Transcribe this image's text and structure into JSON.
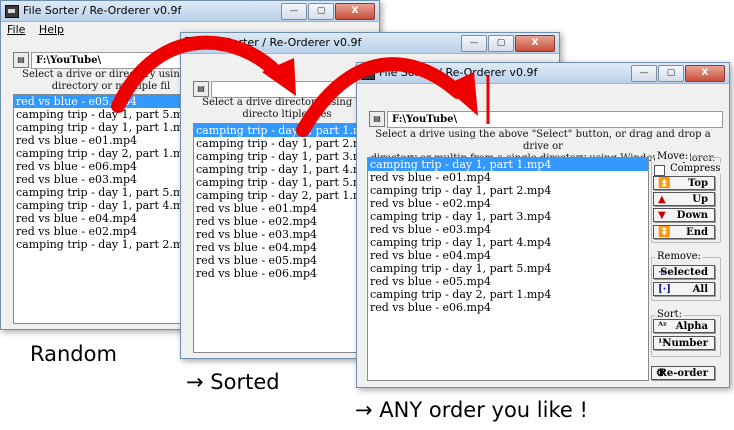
{
  "app": {
    "title": "File Sorter / Re-Orderer v0.9f",
    "title_btns": [
      "—",
      "▢",
      "X"
    ]
  },
  "menu": {
    "file": "File",
    "help": "Help"
  },
  "path": "F:\\YouTube\\",
  "instructions": {
    "win1_line1": "Select a drive or directory using th",
    "win1_line2": "directory or multiple fil",
    "win2_line1": "Select a drive          directory using the",
    "win2_line2": "directo          ltiple files",
    "win3_line1": "Select a drive          using the above \"Select\" button,  or drag and drop a drive or",
    "win3_line2": "directory or multip          from a single directory using Windows Explorer."
  },
  "random_list": [
    "red vs blue - e05.mp4",
    "camping trip - day 1, part 5.mp4",
    "camping trip - day 1, part 1.mp4",
    "red vs blue - e01.mp4",
    "camping trip - day 2, part 1.mp4",
    "red vs blue - e06.mp4",
    "red vs blue - e03.mp4",
    "camping trip - day 1, part 5.mp4",
    "camping trip - day 1, part 4.mp4",
    "red vs blue - e04.mp4",
    "red vs blue - e02.mp4",
    "camping trip - day 1, part 2.mp4"
  ],
  "sorted_list": [
    "camping trip - day 1, part 1.mp4",
    "camping trip - day 1, part 2.mp4",
    "camping trip - day 1, part 3.mp4",
    "camping trip - day 1, part 4.mp4",
    "camping trip - day 1, part 5.mp4",
    "camping trip - day 2, part 1.mp4",
    "red vs blue - e01.mp4",
    "red vs blue - e02.mp4",
    "red vs blue - e03.mp4",
    "red vs blue - e04.mp4",
    "red vs blue - e05.mp4",
    "red vs blue - e06.mp4"
  ],
  "custom_list": [
    "camping trip - day 1, part 1.mp4",
    "red vs blue - e01.mp4",
    "camping trip - day 1, part 2.mp4",
    "red vs blue - e02.mp4",
    "camping trip - day 1, part 3.mp4",
    "red vs blue - e03.mp4",
    "camping trip - day 1, part 4.mp4",
    "red vs blue - e04.mp4",
    "camping trip - day 1, part 5.mp4",
    "red vs blue - e05.mp4",
    "camping trip - day 2, part 1.mp4",
    "red vs blue - e06.mp4"
  ],
  "panel": {
    "move_label": "Move:",
    "compress": "Compress",
    "top": "Top",
    "up": "Up",
    "down": "Down",
    "end": "End",
    "remove_label": "Remove:",
    "selected": "Selected",
    "all": "All",
    "sort_label": "Sort:",
    "alpha": "Alpha",
    "number": "Number",
    "reorder": "Re-order"
  },
  "captions": {
    "random": "Random",
    "sorted": "→  Sorted",
    "any": "→  ANY order you like !"
  },
  "colors": {
    "selection": "#3399ff",
    "arrow": "#ee0000"
  }
}
